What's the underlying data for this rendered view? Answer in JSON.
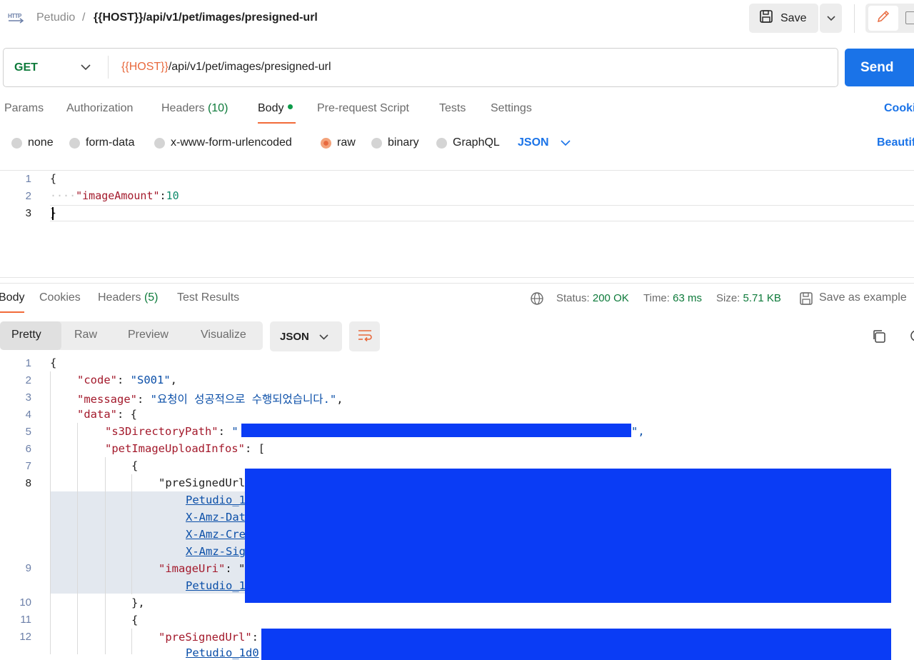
{
  "breadcrumb": {
    "icon": "HTTP",
    "collection": "Petudio",
    "separator": "/",
    "request": "{{HOST}}/api/v1/pet/images/presigned-url"
  },
  "toolbar": {
    "save_label": "Save"
  },
  "request": {
    "method": "GET",
    "url_var": "{{HOST}}",
    "url_path": "/api/v1/pet/images/presigned-url",
    "send_label": "Send"
  },
  "request_tabs": {
    "params": "Params",
    "authorization": "Authorization",
    "headers": "Headers",
    "headers_count": "(10)",
    "body": "Body",
    "pre_request": "Pre-request Script",
    "tests": "Tests",
    "settings": "Settings",
    "cookies": "Cookies"
  },
  "body_types": {
    "none": "none",
    "form_data": "form-data",
    "urlencoded": "x-www-form-urlencoded",
    "raw": "raw",
    "binary": "binary",
    "graphql": "GraphQL",
    "format": "JSON",
    "beautify": "Beautify"
  },
  "request_body": {
    "line_numbers": [
      "1",
      "2",
      "3"
    ],
    "line1": "{",
    "indent": "····",
    "key": "\"imageAmount\"",
    "colon": ":",
    "value": "10",
    "line3": "}"
  },
  "response_tabs": {
    "body": "Body",
    "cookies": "Cookies",
    "headers": "Headers",
    "headers_count": "(5)",
    "test_results": "Test Results"
  },
  "response_meta": {
    "status_label": "Status:",
    "status_value": "200 OK",
    "time_label": "Time:",
    "time_value": "63 ms",
    "size_label": "Size:",
    "size_value": "5.71 KB",
    "save_example": "Save as example"
  },
  "view_modes": {
    "pretty": "Pretty",
    "raw": "Raw",
    "preview": "Preview",
    "visualize": "Visualize",
    "format": "JSON"
  },
  "response_body": {
    "line_numbers": [
      "1",
      "2",
      "3",
      "4",
      "5",
      "6",
      "7",
      "8",
      "9",
      "10",
      "11",
      "12"
    ],
    "l1": "{",
    "l2_key": "\"code\"",
    "l2_val": "\"S001\"",
    "l3_key": "\"message\"",
    "l3_val": "\"요청이 성공적으로 수행되었습니다.\"",
    "l4_key": "\"data\"",
    "l4_rest": ": {",
    "l5_key": "\"s3DirectoryPath\"",
    "l5_open": "\"",
    "l5_close": "\",",
    "l6_key": "\"petImageUploadInfos\"",
    "l6_rest": ": [",
    "l7": "{",
    "l8_key": "\"preSignedUrl",
    "wrap1": "Petudio_1",
    "wrap2": "X-Amz-Dat",
    "wrap3": "X-Amz-Cre",
    "wrap4": "X-Amz-Sig",
    "l9_key": "\"imageUri\"",
    "l9_rest": ": \"",
    "wrap5": "Petudio_1",
    "l10": "},",
    "l11": "{",
    "l12_key": "\"preSignedUrl\"",
    "l12_rest": ":",
    "wrap6": "Petudio_1d0"
  },
  "colors": {
    "send": "#1a73e8",
    "active_tab": "#f26b3a",
    "method": "#0d7a3a",
    "redaction": "#0a3cf5"
  }
}
